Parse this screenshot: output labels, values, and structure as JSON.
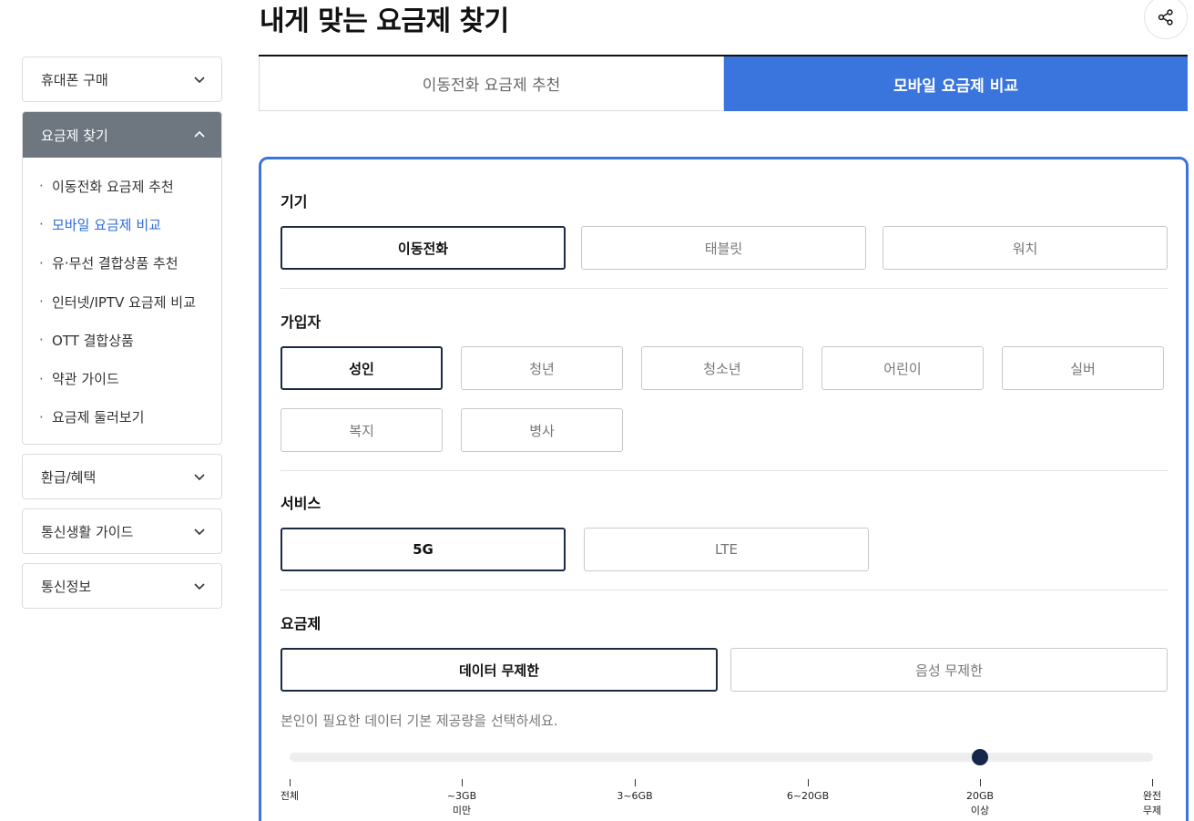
{
  "page": {
    "title": "내게 맞는 요금제 찾기"
  },
  "sidebar": {
    "top_item": "휴대폰 구매",
    "open_group": {
      "label": "요금제 찾기",
      "items": [
        "이동전화 요금제 추천",
        "모바일 요금제 비교",
        "유·무선 결합상품 추천",
        "인터넷/IPTV 요금제 비교",
        "OTT 결합상품",
        "약관 가이드",
        "요금제 둘러보기"
      ],
      "active_index": 1
    },
    "bottom_items": [
      "환급/혜택",
      "통신생활 가이드",
      "통신정보"
    ]
  },
  "tabs": [
    {
      "label": "이동전화 요금제 추천",
      "active": false
    },
    {
      "label": "모바일 요금제 비교",
      "active": true
    }
  ],
  "filters": {
    "device": {
      "label": "기기",
      "options": [
        "이동전화",
        "태블릿",
        "워치"
      ],
      "selected": 0
    },
    "subscriber": {
      "label": "가입자",
      "options": [
        "성인",
        "청년",
        "청소년",
        "어린이",
        "실버",
        "복지",
        "병사"
      ],
      "selected": 0
    },
    "service": {
      "label": "서비스",
      "options": [
        "5G",
        "LTE"
      ],
      "selected": 0
    },
    "plan": {
      "label": "요금제",
      "options": [
        "데이터 무제한",
        "음성 무제한"
      ],
      "selected": 0
    }
  },
  "data_slider": {
    "hint": "본인이 필요한 데이터 기본 제공량을 선택하세요.",
    "ticks": [
      {
        "line1": "전체",
        "line2": ""
      },
      {
        "line1": "~3GB",
        "line2": "미만"
      },
      {
        "line1": "3~6GB",
        "line2": ""
      },
      {
        "line1": "6~20GB",
        "line2": ""
      },
      {
        "line1": "20GB",
        "line2": "이상"
      },
      {
        "line1": "완전",
        "line2": "무제"
      }
    ],
    "selected_index": 4
  },
  "colors": {
    "accent": "#3a74dd",
    "selected_border": "#1b2a44",
    "sidebar_active_bg": "#6e7780",
    "active_link": "#2e6bd9"
  },
  "icons": {
    "share": "share-icon",
    "chevron_down": "chevron-down-icon",
    "chevron_up": "chevron-up-icon"
  }
}
